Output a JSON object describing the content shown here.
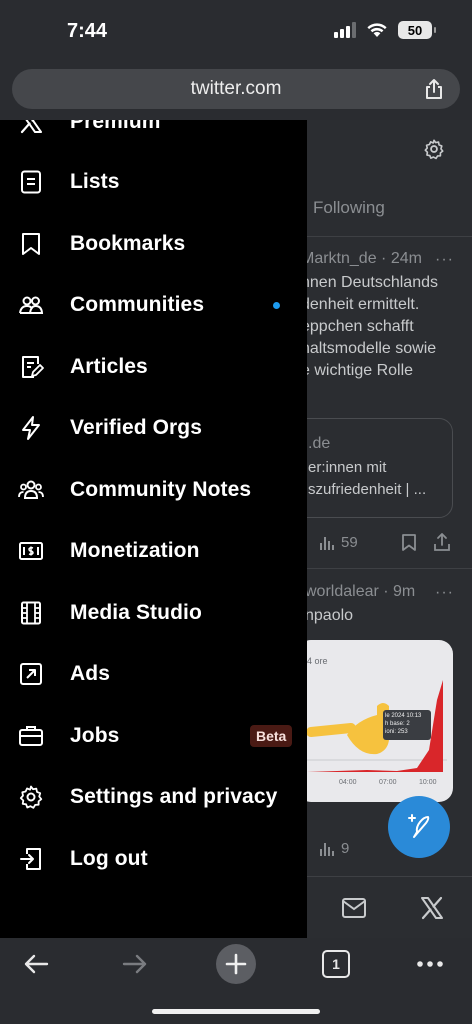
{
  "status_bar": {
    "time": "7:44",
    "battery": "50"
  },
  "browser": {
    "url": "twitter.com",
    "tab_count": "1"
  },
  "drawer": {
    "items": [
      {
        "label": "Premium",
        "icon": "x-logo-icon"
      },
      {
        "label": "Lists",
        "icon": "list-icon"
      },
      {
        "label": "Bookmarks",
        "icon": "bookmark-icon"
      },
      {
        "label": "Communities",
        "icon": "communities-icon"
      },
      {
        "label": "Articles",
        "icon": "article-icon"
      },
      {
        "label": "Verified Orgs",
        "icon": "lightning-icon"
      },
      {
        "label": "Community Notes",
        "icon": "people-icon"
      },
      {
        "label": "Monetization",
        "icon": "money-icon"
      },
      {
        "label": "Media Studio",
        "icon": "film-icon"
      },
      {
        "label": "Ads",
        "icon": "ads-icon"
      },
      {
        "label": "Jobs",
        "icon": "briefcase-icon",
        "badge": "Beta"
      },
      {
        "label": "Settings and privacy",
        "icon": "gear-icon"
      },
      {
        "label": "Log out",
        "icon": "logout-icon"
      }
    ]
  },
  "timeline": {
    "tab_following": "Following",
    "post1": {
      "meta": "Marktn_de · 24m",
      "lines": [
        "nnen Deutschlands",
        "denheit ermittelt.",
        "eppchen schafft",
        "haltsmodelle sowie",
        "e wichtige Rolle"
      ],
      "card_domain": ".de",
      "card_lines": [
        "er:innen mit",
        "szufriedenheit | ..."
      ],
      "views": "59"
    },
    "post2": {
      "meta": "worldalear · 9m",
      "line": "npaolo",
      "chart_label": "4 ore",
      "tooltip": [
        "le 2024 10:13",
        "h base: 2",
        "ioni: 253"
      ],
      "x_ticks": [
        "04:00",
        "07:00",
        "10:00"
      ],
      "views": "9"
    }
  },
  "colors": {
    "accent": "#1d9bf0",
    "beta_bg": "#4a1a14",
    "background": "#000000"
  }
}
